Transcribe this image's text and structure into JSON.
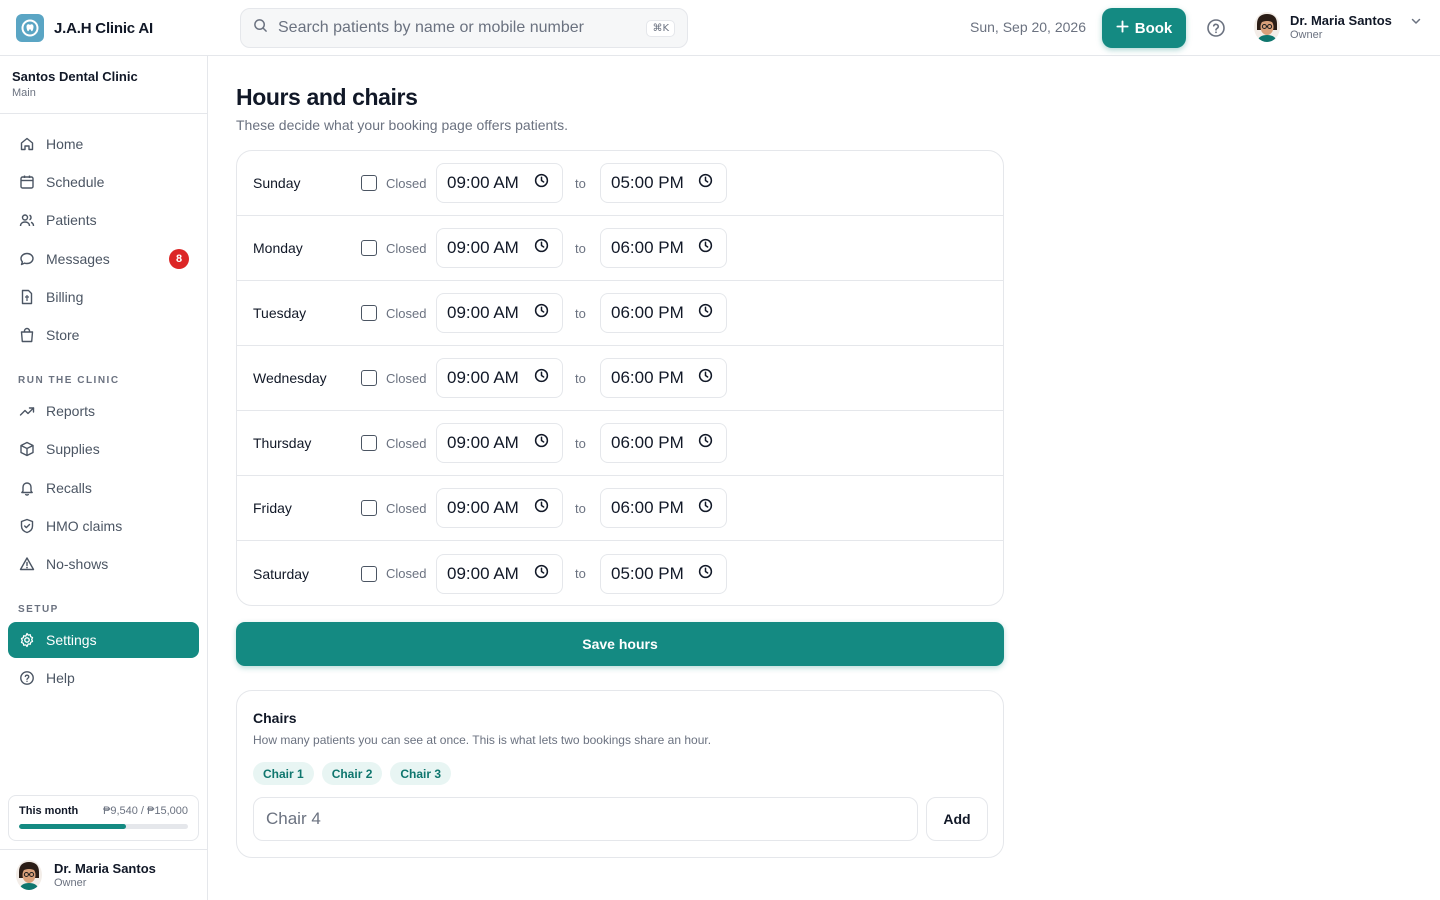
{
  "app": {
    "name": "J.A.H Clinic AI",
    "logo_icon": "tooth-icon"
  },
  "search": {
    "placeholder": "Search patients by name or mobile number",
    "shortcut": "⌘K"
  },
  "header": {
    "date": "Sun, Sep 20, 2026",
    "book_label": "Book"
  },
  "user": {
    "name": "Dr. Maria Santos",
    "role": "Owner"
  },
  "clinic": {
    "name": "Santos Dental Clinic",
    "branch": "Main"
  },
  "sidebar": {
    "items": [
      {
        "label": "Home",
        "icon": "home-icon"
      },
      {
        "label": "Schedule",
        "icon": "calendar-icon"
      },
      {
        "label": "Patients",
        "icon": "users-icon"
      },
      {
        "label": "Messages",
        "icon": "message-icon",
        "badge": "8"
      },
      {
        "label": "Billing",
        "icon": "receipt-icon"
      },
      {
        "label": "Store",
        "icon": "shopping-bag-icon"
      }
    ],
    "section_run": "RUN THE CLINIC",
    "run_items": [
      {
        "label": "Reports",
        "icon": "trending-up-icon"
      },
      {
        "label": "Supplies",
        "icon": "package-icon"
      },
      {
        "label": "Recalls",
        "icon": "bell-icon"
      },
      {
        "label": "HMO claims",
        "icon": "shield-icon"
      },
      {
        "label": "No-shows",
        "icon": "warning-icon"
      }
    ],
    "section_setup": "SETUP",
    "setup_items": [
      {
        "label": "Settings",
        "icon": "gear-icon",
        "active": true
      },
      {
        "label": "Help",
        "icon": "help-icon"
      }
    ]
  },
  "budget": {
    "label": "This month",
    "value": "₱9,540 / ₱15,000",
    "progress": 0.636
  },
  "page": {
    "title": "Hours and chairs",
    "subtitle": "These decide what your booking page offers patients."
  },
  "hours": {
    "closed_label": "Closed",
    "to_label": "to",
    "days": [
      {
        "day": "Sunday",
        "open": "09:00 AM",
        "close": "05:00 PM",
        "closed": false
      },
      {
        "day": "Monday",
        "open": "09:00 AM",
        "close": "06:00 PM",
        "closed": false
      },
      {
        "day": "Tuesday",
        "open": "09:00 AM",
        "close": "06:00 PM",
        "closed": false
      },
      {
        "day": "Wednesday",
        "open": "09:00 AM",
        "close": "06:00 PM",
        "closed": false
      },
      {
        "day": "Thursday",
        "open": "09:00 AM",
        "close": "06:00 PM",
        "closed": false
      },
      {
        "day": "Friday",
        "open": "09:00 AM",
        "close": "06:00 PM",
        "closed": false
      },
      {
        "day": "Saturday",
        "open": "09:00 AM",
        "close": "05:00 PM",
        "closed": false
      }
    ],
    "save_label": "Save hours"
  },
  "chairs": {
    "title": "Chairs",
    "subtitle": "How many patients you can see at once. This is what lets two bookings share an hour.",
    "list": [
      "Chair 1",
      "Chair 2",
      "Chair 3"
    ],
    "input_placeholder": "Chair 4",
    "add_label": "Add"
  },
  "colors": {
    "accent": "#148a82",
    "badge": "#dc2626",
    "chip_bg": "#e8f5f3"
  }
}
